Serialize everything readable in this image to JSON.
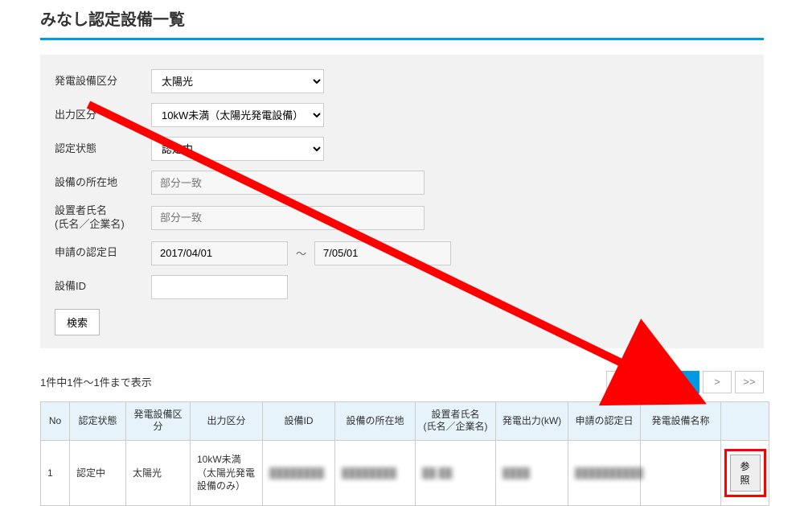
{
  "page_title": "みなし認定設備一覧",
  "filters": {
    "equip_type": {
      "label": "発電設備区分",
      "value": "太陽光"
    },
    "output_cat": {
      "label": "出力区分",
      "value": "10kW未満（太陽光発電設備）"
    },
    "status": {
      "label": "認定状態",
      "value": "認定中"
    },
    "location": {
      "label": "設備の所在地",
      "placeholder": "部分一致",
      "value": ""
    },
    "installer": {
      "label": "設置者氏名\n(氏名／企業名)",
      "placeholder": "部分一致",
      "value": ""
    },
    "cert_date": {
      "label": "申請の認定日",
      "from": "2017/04/01",
      "to": "7/05/01",
      "sep": "～"
    },
    "equip_id": {
      "label": "設備ID",
      "value": ""
    }
  },
  "search_button": "検索",
  "result_count": "1件中1件～1件まで表示",
  "pager": {
    "first": "<<",
    "prev": "<",
    "current": "1",
    "next": ">",
    "last": ">>"
  },
  "table": {
    "headers": {
      "no": "No",
      "status": "認定状態",
      "equip_type": "発電設備区分",
      "output_cat": "出力区分",
      "equip_id": "設備ID",
      "location": "設備の所在地",
      "installer": "設置者氏名\n(氏名／企業名)",
      "output_kw": "発電出力(kW)",
      "cert_date": "申請の認定日",
      "equip_name": "発電設備名称",
      "action": ""
    },
    "rows": [
      {
        "no": "1",
        "status": "認定中",
        "equip_type": "太陽光",
        "output_cat": "10kW未満（太陽光発電設備のみ）",
        "equip_id": "████████",
        "location": "████████",
        "installer": "██ ██",
        "output_kw": "████",
        "cert_date": "██████████",
        "equip_name": "",
        "action_label": "参照"
      }
    ]
  }
}
